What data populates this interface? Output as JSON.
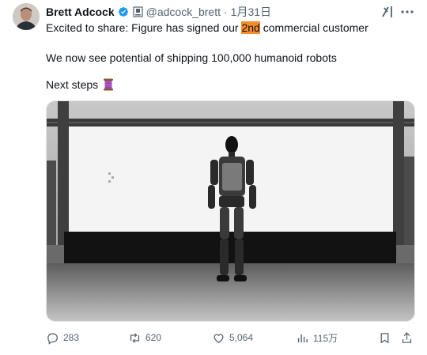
{
  "author": {
    "name": "Brett Adcock",
    "handle": "@adcock_brett",
    "separator": "·",
    "date": "1月31日"
  },
  "tweet": {
    "line1_before": "Excited to share: Figure has signed our ",
    "line1_highlight": "2nd",
    "line1_after": " commercial customer",
    "line2": "We now see potential of shipping 100,000 humanoid robots",
    "line3": "Next steps"
  },
  "actions": {
    "replies": "283",
    "reposts": "620",
    "likes": "5,064",
    "views": "115万"
  },
  "icons": {
    "verified": "verified-badge-icon",
    "handle": "bookmark-profile-icon",
    "grok": "grok-icon",
    "more": "more-icon",
    "emoji": "thread-spool-emoji",
    "reply": "reply-icon",
    "repost": "repost-icon",
    "like": "like-icon",
    "views": "views-icon",
    "bookmark": "bookmark-icon",
    "share": "share-icon"
  },
  "colors": {
    "highlight": "#f78c2b",
    "verified": "#1d9bf0",
    "muted": "#536471",
    "text": "#0f1419"
  }
}
